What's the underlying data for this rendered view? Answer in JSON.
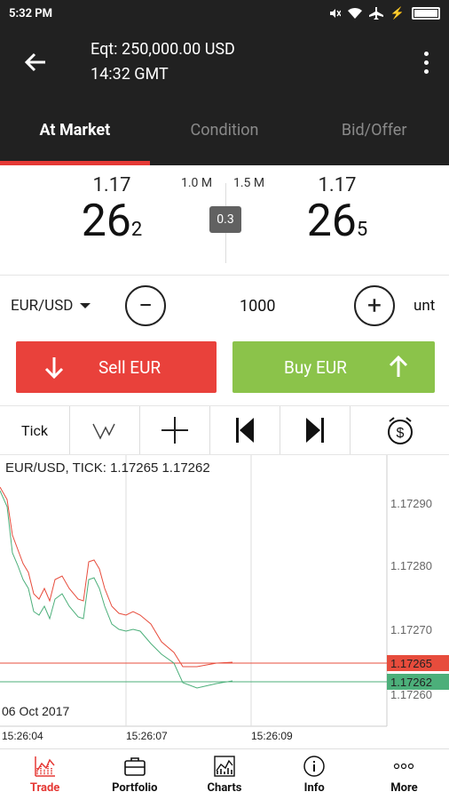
{
  "status_bar": {
    "time": "5:32 PM"
  },
  "header": {
    "equity": "Eqt: 250,000.00 USD",
    "time": "14:32 GMT"
  },
  "tabs": [
    {
      "label": "At Market",
      "active": true
    },
    {
      "label": "Condition",
      "active": false
    },
    {
      "label": "Bid/Offer",
      "active": false
    }
  ],
  "prices": {
    "bid": {
      "big": "1.17",
      "pips": "26",
      "fraction": "2",
      "size": "1.0 M"
    },
    "ask": {
      "big": "1.17",
      "pips": "26",
      "fraction": "5",
      "size": "1.5 M"
    },
    "spread": "0.3"
  },
  "order": {
    "pair": "EUR/USD",
    "quantity": "1000",
    "unit": "unt",
    "minus": "−",
    "plus": "+"
  },
  "buttons": {
    "sell": "Sell EUR",
    "buy": "Buy EUR"
  },
  "toolbar": {
    "tick_label": "Tick"
  },
  "chart": {
    "header": "EUR/USD, TICK: 1.17265 1.17262",
    "date_label": "06 Oct 2017",
    "y_ticks": [
      "1.17290",
      "1.17280",
      "1.17270",
      "1.17260"
    ],
    "x_ticks": [
      "15:26:04",
      "15:26:07",
      "15:26:09"
    ],
    "ask_label": "1.17265",
    "bid_label": "1.17262",
    "ask_color": "#e74c3c",
    "bid_color": "#4caf7a"
  },
  "nav": [
    {
      "label": "Trade",
      "icon": "trade-icon",
      "active": true
    },
    {
      "label": "Portfolio",
      "icon": "portfolio-icon",
      "active": false
    },
    {
      "label": "Charts",
      "icon": "charts-icon",
      "active": false
    },
    {
      "label": "Info",
      "icon": "info-icon",
      "active": false
    },
    {
      "label": "More",
      "icon": "more-icon",
      "active": false
    }
  ]
}
